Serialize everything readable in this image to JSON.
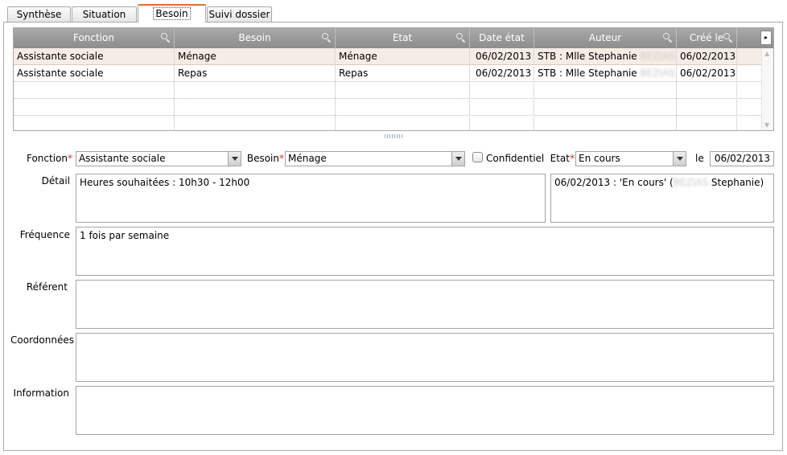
{
  "tabs": [
    "Synthèse",
    "Situation",
    "Besoin",
    "Suivi dossier"
  ],
  "grid": {
    "columns": [
      "Fonction",
      "Besoin",
      "Etat",
      "Date état",
      "Auteur",
      "Créé le"
    ],
    "rows": [
      {
        "fonction": "Assistante sociale",
        "besoin": "Ménage",
        "etat": "Ménage",
        "date_etat": "06/02/2013",
        "auteur": "STB : Mlle Stephanie",
        "auteur_redacted": "BEZIAS",
        "cree_le": "06/02/2013"
      },
      {
        "fonction": "Assistante sociale",
        "besoin": "Repas",
        "etat": "Repas",
        "date_etat": "06/02/2013",
        "auteur": "STB : Mlle Stephanie",
        "auteur_redacted": "BEZIAS",
        "cree_le": "06/02/2013"
      }
    ]
  },
  "form": {
    "fonction_label": "Fonction",
    "fonction_value": "Assistante sociale",
    "besoin_label": "Besoin",
    "besoin_value": "Ménage",
    "confidentiel_label": "Confidentiel",
    "etat_label": "Etat",
    "etat_value": "En cours",
    "le_label": "le",
    "le_value": "06/02/2013",
    "required_mark": "*",
    "detail_label": "Détail",
    "detail_value": "Heures souhaitées : 10h30 - 12h00",
    "history_prefix": "06/02/2013 : 'En cours' (",
    "history_redacted": "BEZIAS",
    "history_suffix": " Stephanie)",
    "frequence_label": "Fréquence",
    "frequence_value": "1 fois par semaine",
    "referent_label": "Référent",
    "referent_value": "",
    "coordonnees_label": "Coordonnées",
    "coordonnees_value": "",
    "information_label": "Information",
    "information_value": ""
  },
  "colors": {
    "accent": "#e0702a",
    "header_bg": "#9b9b9b",
    "selected_row": "#f6ece6",
    "required": "#d32f2f"
  }
}
